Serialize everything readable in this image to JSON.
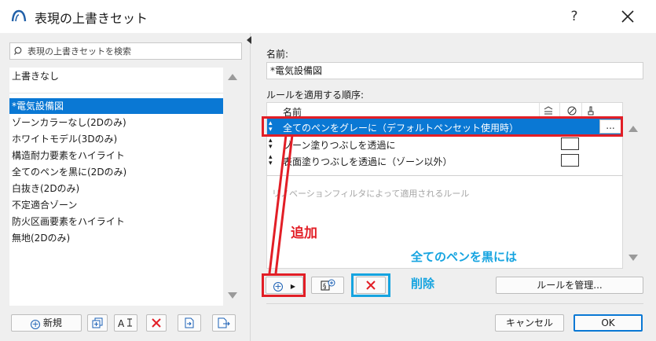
{
  "window": {
    "title": "表現の上書きセット",
    "help_label": "?"
  },
  "search": {
    "placeholder": "表現の上書きセットを検索"
  },
  "set_list": {
    "top_item": "上書きなし",
    "items": [
      "*電気設備図",
      "ゾーンカラーなし(2Dのみ)",
      "ホワイトモデル(3Dのみ)",
      "構造耐力要素をハイライト",
      "全てのペンを黒に(2Dのみ)",
      "白抜き(2Dのみ)",
      "不定適合ゾーン",
      "防火区画要素をハイライト",
      "無地(2Dのみ)"
    ],
    "selected_index": 0
  },
  "left_toolbar": {
    "new_label": "新規",
    "new_icon": "plus-circle-icon"
  },
  "details": {
    "name_label": "名前:",
    "name_value": "*電気設備図",
    "order_label": "ルールを適用する順序:",
    "column_name": "名前",
    "rules": [
      {
        "label": "全てのペンをグレーに（デフォルトペンセット使用時）",
        "selected": true
      },
      {
        "label": "ゾーン塗りつぶしを透過に",
        "selected": false
      },
      {
        "label": "表面塗りつぶしを透過に（ゾーン以外）",
        "selected": false
      }
    ],
    "dots_label": "...",
    "renovation_text": "リノベーションフィルタによって適用されるルール",
    "manage_label": "ルールを管理..."
  },
  "annotations": {
    "add_label": "追加",
    "remove_line1": "全てのペンを黒には",
    "remove_line2": "削除"
  },
  "footer": {
    "cancel_label": "キャンセル",
    "ok_label": "OK"
  },
  "colors": {
    "accent": "#0a78d4",
    "annotation_red": "#e21e26",
    "annotation_blue": "#16a4e0"
  }
}
